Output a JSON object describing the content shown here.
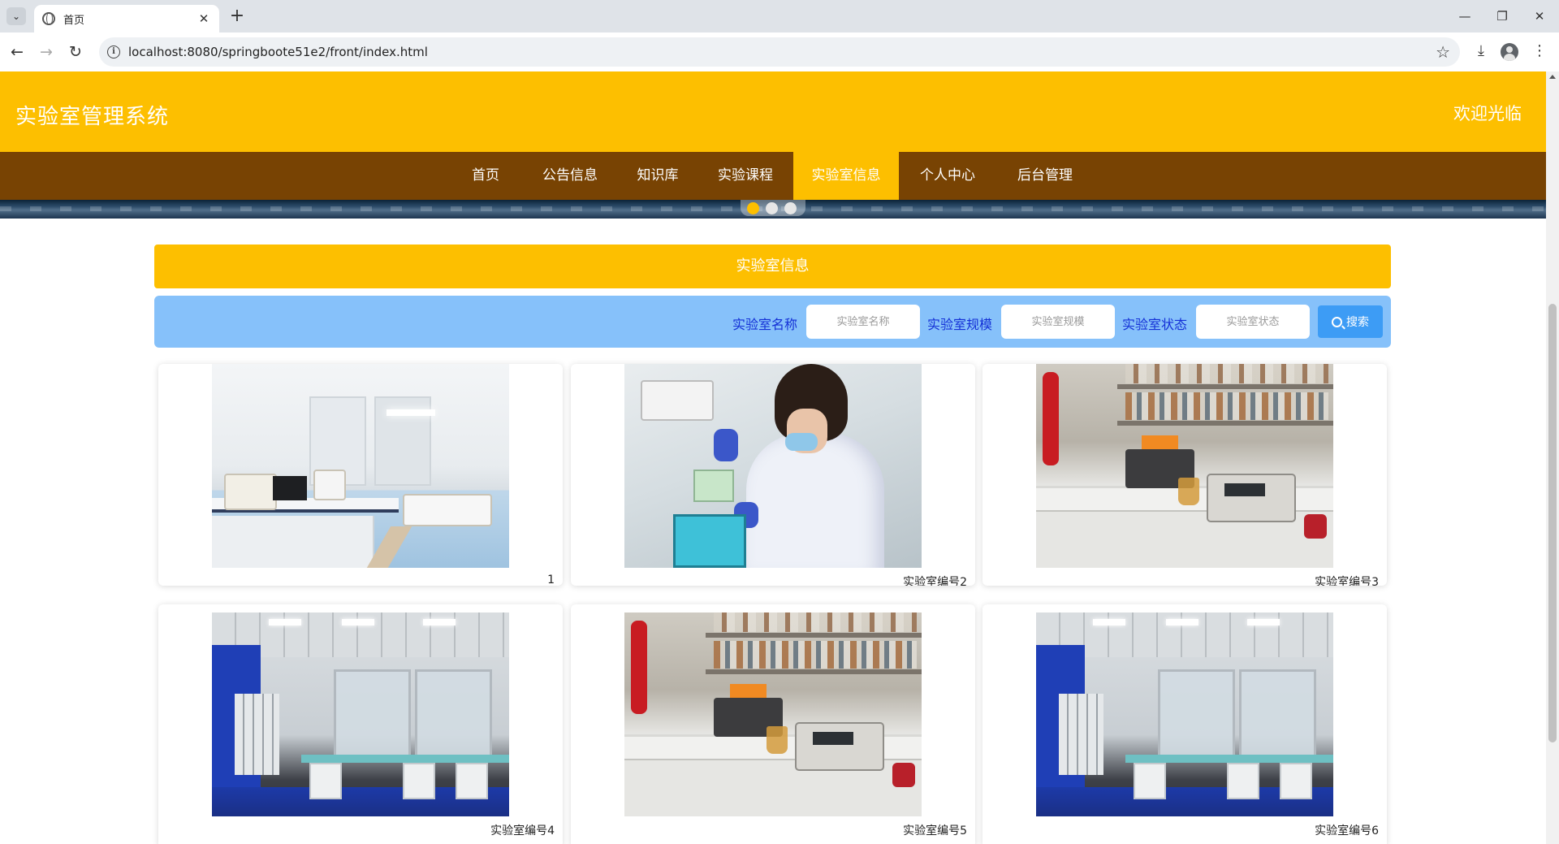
{
  "browser": {
    "tab_title": "首页",
    "tab_close": "✕",
    "new_tab": "+",
    "url": "localhost:8080/springboote51e2/front/index.html",
    "window_controls": {
      "minimize": "—",
      "restore": "❐",
      "close": "✕"
    }
  },
  "site": {
    "title": "实验室管理系统",
    "welcome": "欢迎光临"
  },
  "nav": {
    "items": [
      {
        "label": "首页"
      },
      {
        "label": "公告信息"
      },
      {
        "label": "知识库"
      },
      {
        "label": "实验课程"
      },
      {
        "label": "实验室信息",
        "active": true
      },
      {
        "label": "个人中心"
      },
      {
        "label": "后台管理"
      }
    ]
  },
  "carousel": {
    "dot_count": 3,
    "active_index": 0
  },
  "section": {
    "title": "实验室信息"
  },
  "search": {
    "name_label": "实验室名称",
    "name_placeholder": "实验室名称",
    "scale_label": "实验室规模",
    "scale_placeholder": "实验室规模",
    "status_label": "实验室状态",
    "status_placeholder": "实验室状态",
    "button_label": "搜索"
  },
  "labs": [
    {
      "caption": "1",
      "photo": "clean-room-lab"
    },
    {
      "caption": "实验室编号2",
      "photo": "scientist-pipetting"
    },
    {
      "caption": "实验室编号3",
      "photo": "chemistry-bench"
    },
    {
      "caption": "实验室编号4",
      "photo": "modern-lab-room"
    },
    {
      "caption": "实验室编号5",
      "photo": "chemistry-bench"
    },
    {
      "caption": "实验室编号6",
      "photo": "modern-lab-room"
    }
  ],
  "colors": {
    "header": "#fdbf00",
    "nav": "#784303",
    "search_panel": "#86c1fa",
    "search_label": "#1430d6",
    "search_button": "#3d9cf5"
  }
}
